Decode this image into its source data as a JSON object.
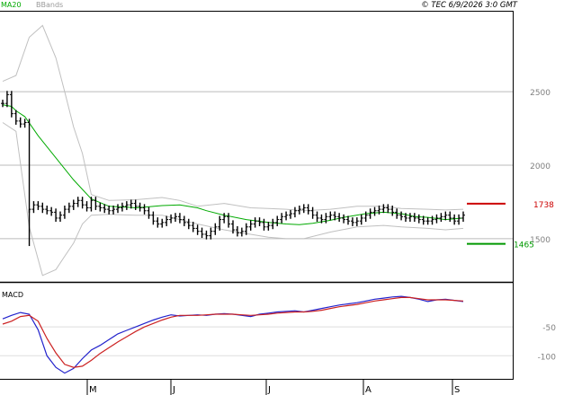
{
  "header": {
    "legend_items": [
      "MA20",
      "BBands"
    ],
    "copyright": "© TEC 6/9/2026 3:0 GMT"
  },
  "colors": {
    "price": "#000000",
    "ma20": "#00aa00",
    "bbands": "#c0c0c0",
    "resistance": "#cc0000",
    "support": "#009900",
    "macd": "#2222cc",
    "signal": "#cc2222",
    "grid": "#bbbbbb",
    "frame": "#000000"
  },
  "chart_data": [
    {
      "type": "line",
      "name": "price-panel",
      "x_ticks": [
        "M",
        "J",
        "J",
        "A",
        "S"
      ],
      "y_ticks": [
        "2500",
        "2000",
        "1500"
      ],
      "ylim": [
        1200,
        3050
      ],
      "grid": "horizontal",
      "levels": [
        {
          "role": "resistance",
          "label": "1738",
          "value": 1738
        },
        {
          "role": "support",
          "label": "1465",
          "value": 1465
        }
      ],
      "series": [
        {
          "name": "MA20",
          "x": [
            0,
            2,
            3,
            5,
            8,
            12,
            16,
            20,
            24,
            28,
            30,
            32,
            36,
            40,
            44,
            46,
            50,
            55,
            60,
            64,
            67,
            70,
            74,
            77,
            82,
            86,
            90,
            93,
            96,
            100,
            104
          ],
          "values": [
            2410,
            2400,
            2370,
            2330,
            2200,
            2050,
            1900,
            1770,
            1720,
            1715,
            1710,
            1715,
            1725,
            1730,
            1710,
            1690,
            1660,
            1630,
            1610,
            1600,
            1595,
            1605,
            1625,
            1645,
            1670,
            1680,
            1670,
            1650,
            1645,
            1630,
            1640
          ]
        },
        {
          "name": "BBands upper",
          "x": [
            0,
            3,
            6,
            9,
            12,
            14,
            16,
            18,
            20,
            24,
            30,
            36,
            40,
            44,
            50,
            56,
            60,
            64,
            68,
            74,
            80,
            86,
            90,
            96,
            100,
            104
          ],
          "values": [
            2570,
            2610,
            2870,
            2950,
            2730,
            2500,
            2260,
            2080,
            1800,
            1760,
            1765,
            1780,
            1760,
            1720,
            1740,
            1710,
            1705,
            1700,
            1690,
            1700,
            1720,
            1720,
            1705,
            1700,
            1695,
            1700
          ]
        },
        {
          "name": "BBands lower",
          "x": [
            0,
            3,
            6,
            9,
            12,
            14,
            16,
            18,
            20,
            24,
            30,
            36,
            40,
            44,
            50,
            56,
            60,
            64,
            68,
            74,
            80,
            86,
            90,
            96,
            100,
            104
          ],
          "values": [
            2290,
            2230,
            1580,
            1250,
            1290,
            1380,
            1470,
            1600,
            1660,
            1665,
            1660,
            1660,
            1630,
            1600,
            1560,
            1530,
            1510,
            1500,
            1500,
            1545,
            1580,
            1590,
            1580,
            1570,
            1560,
            1570
          ]
        },
        {
          "name": "Price",
          "x": [
            0,
            1,
            2,
            3,
            4,
            5,
            6,
            7,
            8,
            9,
            10,
            11,
            12,
            13,
            14,
            15,
            16,
            17,
            18,
            19,
            20,
            21,
            22,
            23,
            24,
            25,
            26,
            27,
            28,
            29,
            30,
            31,
            32,
            33,
            34,
            35,
            36,
            37,
            38,
            39,
            40,
            41,
            42,
            43,
            44,
            45,
            46,
            47,
            48,
            49,
            50,
            51,
            52,
            53,
            54,
            55,
            56,
            57,
            58,
            59,
            60,
            61,
            62,
            63,
            64,
            65,
            66,
            67,
            68,
            69,
            70,
            71,
            72,
            73,
            74,
            75,
            76,
            77,
            78,
            79,
            80,
            81,
            82,
            83,
            84,
            85,
            86,
            87,
            88,
            89,
            90,
            91,
            92,
            93,
            94,
            95,
            96,
            97,
            98,
            99,
            100,
            101,
            102,
            103,
            104
          ],
          "values": [
            2420,
            2480,
            2350,
            2300,
            2280,
            2290,
            1700,
            1730,
            1720,
            1700,
            1690,
            1680,
            1640,
            1660,
            1700,
            1720,
            1740,
            1760,
            1730,
            1710,
            1760,
            1720,
            1710,
            1700,
            1690,
            1700,
            1710,
            1720,
            1730,
            1740,
            1720,
            1710,
            1690,
            1660,
            1620,
            1600,
            1610,
            1630,
            1640,
            1650,
            1630,
            1610,
            1590,
            1570,
            1550,
            1530,
            1520,
            1550,
            1580,
            1630,
            1650,
            1600,
            1560,
            1540,
            1550,
            1580,
            1600,
            1620,
            1610,
            1580,
            1590,
            1610,
            1630,
            1650,
            1660,
            1670,
            1690,
            1700,
            1710,
            1690,
            1660,
            1640,
            1630,
            1650,
            1660,
            1650,
            1640,
            1630,
            1620,
            1610,
            1620,
            1640,
            1660,
            1680,
            1690,
            1700,
            1710,
            1700,
            1680,
            1660,
            1650,
            1640,
            1650,
            1640,
            1630,
            1620,
            1620,
            1630,
            1640,
            1650,
            1660,
            1640,
            1620,
            1640,
            1660
          ]
        }
      ]
    },
    {
      "type": "line",
      "name": "macd-panel",
      "title": "MACD",
      "y_ticks": [
        "-50",
        "-100"
      ],
      "ylim": [
        -140,
        25
      ],
      "series": [
        {
          "name": "MACD",
          "x": [
            0,
            2,
            4,
            6,
            8,
            10,
            12,
            14,
            16,
            18,
            20,
            22,
            24,
            26,
            28,
            30,
            32,
            34,
            36,
            38,
            40,
            42,
            44,
            46,
            48,
            50,
            52,
            54,
            56,
            58,
            60,
            62,
            64,
            66,
            68,
            70,
            72,
            74,
            76,
            78,
            80,
            82,
            84,
            86,
            88,
            90,
            92,
            94,
            96,
            98,
            100,
            102,
            104
          ],
          "values": [
            -36,
            -30,
            -25,
            -28,
            -55,
            -100,
            -120,
            -130,
            -122,
            -105,
            -90,
            -82,
            -72,
            -62,
            -56,
            -50,
            -44,
            -38,
            -33,
            -29,
            -31,
            -30,
            -29,
            -30,
            -28,
            -27,
            -28,
            -30,
            -32,
            -28,
            -26,
            -24,
            -23,
            -22,
            -24,
            -21,
            -18,
            -15,
            -12,
            -10,
            -8,
            -5,
            -2,
            0,
            2,
            3,
            1,
            -2,
            -6,
            -3,
            -2,
            -4,
            -6
          ]
        },
        {
          "name": "Signal",
          "x": [
            0,
            2,
            4,
            6,
            8,
            10,
            12,
            14,
            16,
            18,
            20,
            22,
            24,
            26,
            28,
            30,
            32,
            34,
            36,
            38,
            40,
            42,
            44,
            46,
            48,
            50,
            52,
            54,
            56,
            58,
            60,
            62,
            64,
            66,
            68,
            70,
            72,
            74,
            76,
            78,
            80,
            82,
            84,
            86,
            88,
            90,
            92,
            94,
            96,
            98,
            100,
            102,
            104
          ],
          "values": [
            -45,
            -40,
            -32,
            -30,
            -40,
            -70,
            -95,
            -115,
            -120,
            -118,
            -108,
            -96,
            -86,
            -76,
            -67,
            -58,
            -50,
            -44,
            -38,
            -33,
            -30,
            -30,
            -30,
            -29,
            -28,
            -28,
            -28,
            -29,
            -30,
            -29,
            -28,
            -26,
            -25,
            -24,
            -24,
            -23,
            -21,
            -18,
            -15,
            -13,
            -11,
            -8,
            -5,
            -3,
            -1,
            1,
            1,
            -1,
            -3,
            -3,
            -3,
            -4,
            -5
          ]
        }
      ]
    }
  ]
}
